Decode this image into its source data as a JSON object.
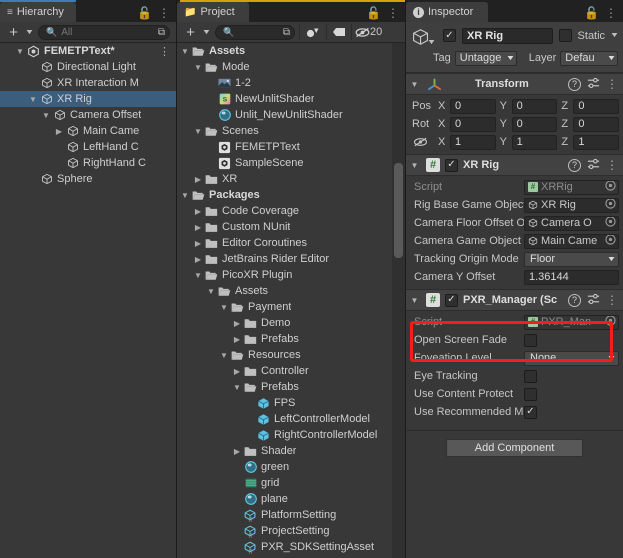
{
  "window": {
    "accent_blue": "#3d7bbd",
    "accent_yellow": "#d8a007",
    "annotation_red": "#fc1b1b",
    "selection_blue": "#3b5e7e"
  },
  "hierarchy": {
    "tab_label": "Hierarchy",
    "tab_icon": "hierarchy-icon",
    "lock_icon": "lock-open-icon",
    "menu_icon": "kebab-menu-icon",
    "toolbar": {
      "add_label": "+",
      "add_dropdown_icon": "chevron-down-icon",
      "search_placeholder": "All",
      "search_value": "",
      "search_icon": "search-icon",
      "expand_icon": "expand-search-icon"
    },
    "items": [
      {
        "label": "FEMETPText*",
        "icon": "scene-icon",
        "indent": 0,
        "twisty": "down",
        "bold": true,
        "selected": false,
        "kebab": true
      },
      {
        "label": "Directional Light",
        "icon": "gameobject-icon",
        "indent": 1,
        "twisty": "",
        "bold": false,
        "selected": false,
        "kebab": false
      },
      {
        "label": "XR Interaction M",
        "icon": "gameobject-icon",
        "indent": 1,
        "twisty": "",
        "bold": false,
        "selected": false,
        "kebab": false
      },
      {
        "label": "XR Rig",
        "icon": "gameobject-icon",
        "indent": 1,
        "twisty": "down",
        "bold": false,
        "selected": true,
        "kebab": false
      },
      {
        "label": "Camera Offset",
        "icon": "gameobject-icon",
        "indent": 2,
        "twisty": "down",
        "bold": false,
        "selected": false,
        "kebab": false
      },
      {
        "label": "Main Came",
        "icon": "gameobject-icon",
        "indent": 3,
        "twisty": "right",
        "bold": false,
        "selected": false,
        "kebab": false
      },
      {
        "label": "LeftHand C",
        "icon": "gameobject-icon",
        "indent": 3,
        "twisty": "",
        "bold": false,
        "selected": false,
        "kebab": false
      },
      {
        "label": "RightHand C",
        "icon": "gameobject-icon",
        "indent": 3,
        "twisty": "",
        "bold": false,
        "selected": false,
        "kebab": false
      },
      {
        "label": "Sphere",
        "icon": "gameobject-icon",
        "indent": 1,
        "twisty": "",
        "bold": false,
        "selected": false,
        "kebab": false
      }
    ]
  },
  "project": {
    "tab_label": "Project",
    "tab_icon": "folder-icon",
    "lock_icon": "lock-open-icon",
    "menu_icon": "kebab-menu-icon",
    "toolbar": {
      "add_label": "+",
      "add_dropdown_icon": "chevron-down-icon",
      "search_placeholder": "",
      "search_value": "",
      "search_icon": "search-icon",
      "expand_icon": "expand-search-icon",
      "filter_type_icon": "filter-by-type-icon",
      "filter_label_icon": "filter-by-label-icon",
      "hidden_icon": "eye-crossed-icon",
      "hidden_count": "20"
    },
    "items": [
      {
        "label": "Assets",
        "icon": "folder-open-icon",
        "indent": 0,
        "twisty": "down",
        "bold": true
      },
      {
        "label": "Mode",
        "icon": "folder-open-icon",
        "indent": 1,
        "twisty": "down",
        "bold": false
      },
      {
        "label": "1-2",
        "icon": "image-icon",
        "indent": 2,
        "twisty": "",
        "bold": false
      },
      {
        "label": "NewUnlitShader",
        "icon": "shader-icon",
        "indent": 2,
        "twisty": "",
        "bold": false
      },
      {
        "label": "Unlit_NewUnlitShader",
        "icon": "material-icon",
        "indent": 2,
        "twisty": "",
        "bold": false
      },
      {
        "label": "Scenes",
        "icon": "folder-open-icon",
        "indent": 1,
        "twisty": "down",
        "bold": false
      },
      {
        "label": "FEMETPText",
        "icon": "scene-asset-icon",
        "indent": 2,
        "twisty": "",
        "bold": false
      },
      {
        "label": "SampleScene",
        "icon": "scene-asset-icon",
        "indent": 2,
        "twisty": "",
        "bold": false
      },
      {
        "label": "XR",
        "icon": "folder-icon",
        "indent": 1,
        "twisty": "right",
        "bold": false
      },
      {
        "label": "Packages",
        "icon": "folder-open-icon",
        "indent": 0,
        "twisty": "down",
        "bold": true
      },
      {
        "label": "Code Coverage",
        "icon": "folder-icon",
        "indent": 1,
        "twisty": "right",
        "bold": false
      },
      {
        "label": "Custom NUnit",
        "icon": "folder-icon",
        "indent": 1,
        "twisty": "right",
        "bold": false
      },
      {
        "label": "Editor Coroutines",
        "icon": "folder-icon",
        "indent": 1,
        "twisty": "right",
        "bold": false
      },
      {
        "label": "JetBrains Rider Editor",
        "icon": "folder-icon",
        "indent": 1,
        "twisty": "right",
        "bold": false
      },
      {
        "label": "PicoXR Plugin",
        "icon": "folder-open-icon",
        "indent": 1,
        "twisty": "down",
        "bold": false
      },
      {
        "label": "Assets",
        "icon": "folder-open-icon",
        "indent": 2,
        "twisty": "down",
        "bold": false
      },
      {
        "label": "Payment",
        "icon": "folder-open-icon",
        "indent": 3,
        "twisty": "down",
        "bold": false
      },
      {
        "label": "Demo",
        "icon": "folder-icon",
        "indent": 4,
        "twisty": "right",
        "bold": false
      },
      {
        "label": "Prefabs",
        "icon": "folder-icon",
        "indent": 4,
        "twisty": "right",
        "bold": false
      },
      {
        "label": "Resources",
        "icon": "folder-open-icon",
        "indent": 3,
        "twisty": "down",
        "bold": false
      },
      {
        "label": "Controller",
        "icon": "folder-icon",
        "indent": 4,
        "twisty": "right",
        "bold": false
      },
      {
        "label": "Prefabs",
        "icon": "folder-open-icon",
        "indent": 4,
        "twisty": "down",
        "bold": false
      },
      {
        "label": "FPS",
        "icon": "prefab-icon",
        "indent": 5,
        "twisty": "",
        "bold": false
      },
      {
        "label": "LeftControllerModel",
        "icon": "prefab-icon",
        "indent": 5,
        "twisty": "",
        "bold": false
      },
      {
        "label": "RightControllerModel",
        "icon": "prefab-icon",
        "indent": 5,
        "twisty": "",
        "bold": false
      },
      {
        "label": "Shader",
        "icon": "folder-icon",
        "indent": 4,
        "twisty": "right",
        "bold": false
      },
      {
        "label": "green",
        "icon": "material-icon",
        "indent": 4,
        "twisty": "",
        "bold": false
      },
      {
        "label": "grid",
        "icon": "texture-icon",
        "indent": 4,
        "twisty": "",
        "bold": false
      },
      {
        "label": "plane",
        "icon": "material-icon",
        "indent": 4,
        "twisty": "",
        "bold": false
      },
      {
        "label": "PlatformSetting",
        "icon": "scriptable-object-icon",
        "indent": 4,
        "twisty": "",
        "bold": false
      },
      {
        "label": "ProjectSetting",
        "icon": "scriptable-object-icon",
        "indent": 4,
        "twisty": "",
        "bold": false
      },
      {
        "label": "PXR_SDKSettingAsset",
        "icon": "scriptable-object-icon",
        "indent": 4,
        "twisty": "",
        "bold": false
      }
    ]
  },
  "inspector": {
    "tab_label": "Inspector",
    "tab_icon": "info-icon",
    "lock_icon": "lock-open-icon",
    "menu_icon": "kebab-menu-icon",
    "header": {
      "gameobject_icon": "gameobject-icon",
      "active_checked": true,
      "name_value": "XR Rig",
      "static_label": "Static",
      "static_checked": false,
      "static_dropdown_icon": "chevron-down-icon",
      "tag_label": "Tag",
      "tag_value": "Untagge",
      "layer_label": "Layer",
      "layer_value": "Defau"
    },
    "components": [
      {
        "name": "transform-component",
        "title": "Transform",
        "icon": "transform-icon",
        "has_checkbox": false,
        "help_icon": "help-icon",
        "preset_icon": "preset-icon",
        "menu_icon": "kebab-menu-icon",
        "vectors": [
          {
            "label": "Pos",
            "x": "0",
            "y": "0",
            "z": "0"
          },
          {
            "label": "Rot",
            "x": "0",
            "y": "0",
            "z": "0"
          },
          {
            "label": "",
            "icon": "eye-crossed-icon",
            "x": "1",
            "y": "1",
            "z": "1"
          }
        ]
      },
      {
        "name": "xr-rig-component",
        "title": "XR Rig",
        "icon": "script-icon",
        "has_checkbox": true,
        "checked": true,
        "help_icon": "help-icon",
        "preset_icon": "preset-icon",
        "menu_icon": "kebab-menu-icon",
        "properties": [
          {
            "label": "Script",
            "type": "object",
            "value": "XRRig",
            "icon": "script-icon",
            "dim": true
          },
          {
            "label": "Rig Base Game Object",
            "type": "object",
            "value": "XR Rig",
            "icon": "gameobject-icon",
            "dim": false
          },
          {
            "label": "Camera Floor Offset O",
            "type": "object",
            "value": "Camera O",
            "icon": "gameobject-icon",
            "dim": false
          },
          {
            "label": "Camera Game Object",
            "type": "object",
            "value": "Main Came",
            "icon": "gameobject-icon",
            "dim": false
          },
          {
            "label": "Tracking Origin Mode",
            "type": "dropdown",
            "value": "Floor"
          },
          {
            "label": "Camera Y Offset",
            "type": "value",
            "value": "1.36144"
          }
        ]
      },
      {
        "name": "pxr-manager-component",
        "title": "PXR_Manager (Sc",
        "icon": "script-icon",
        "has_checkbox": true,
        "checked": true,
        "help_icon": "help-icon",
        "preset_icon": "preset-icon",
        "menu_icon": "kebab-menu-icon",
        "highlighted": true,
        "properties": [
          {
            "label": "Script",
            "type": "object",
            "value": "PXR_Man",
            "icon": "script-icon",
            "dim": true
          },
          {
            "label": "Open Screen Fade",
            "type": "checkbox",
            "checked": false
          },
          {
            "label": "Foveation Level",
            "type": "dropdown",
            "value": "None"
          },
          {
            "label": "Eye Tracking",
            "type": "checkbox",
            "checked": false
          },
          {
            "label": "Use Content Protect",
            "type": "checkbox",
            "checked": false
          },
          {
            "label": "Use Recommended M",
            "type": "checkbox",
            "checked": true
          }
        ]
      }
    ],
    "add_component_label": "Add Component"
  }
}
